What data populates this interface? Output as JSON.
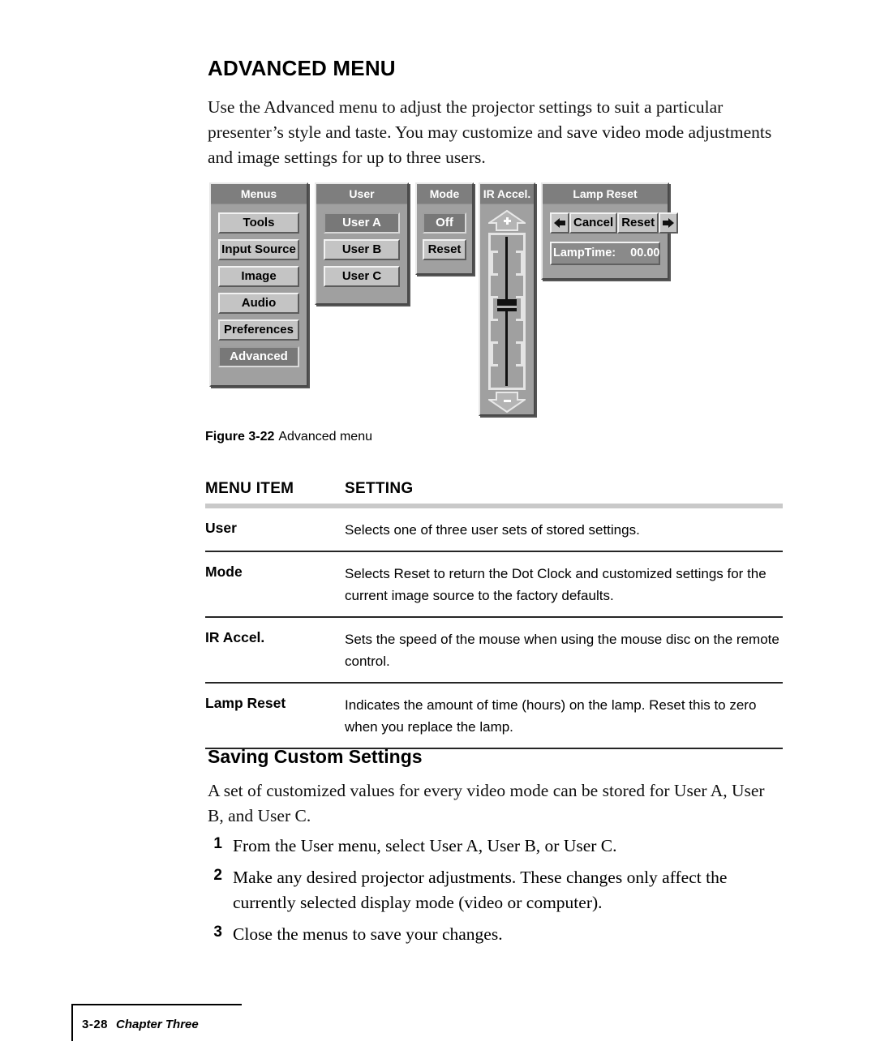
{
  "page": {
    "heading": "ADVANCED MENU",
    "intro_paragraph": "Use the Advanced menu to adjust the projector settings to suit a particular presenter’s style and taste. You may customize and save video mode adjustments and image settings for up to three users."
  },
  "figure": {
    "label": "Figure 3-22",
    "caption": "Advanced menu",
    "panels": {
      "menus": {
        "title": "Menus",
        "items": [
          {
            "label": "Tools",
            "selected": false
          },
          {
            "label": "Input Source",
            "selected": false
          },
          {
            "label": "Image",
            "selected": false
          },
          {
            "label": "Audio",
            "selected": false
          },
          {
            "label": "Preferences",
            "selected": false
          },
          {
            "label": "Advanced",
            "selected": true
          }
        ]
      },
      "user": {
        "title": "User",
        "items": [
          {
            "label": "User A",
            "selected": true
          },
          {
            "label": "User B",
            "selected": false
          },
          {
            "label": "User C",
            "selected": false
          }
        ]
      },
      "mode": {
        "title": "Mode",
        "items": [
          {
            "label": "Off",
            "selected": true
          },
          {
            "label": "Reset",
            "selected": false
          }
        ]
      },
      "ir_accel": {
        "title": "IR Accel.",
        "increase_icon": "up-arrow-plus-icon",
        "decrease_icon": "down-arrow-minus-icon",
        "slider_position_percent": 45
      },
      "lamp_reset": {
        "title": "Lamp Reset",
        "left_arrow_icon": "left-arrow-icon",
        "right_arrow_icon": "right-arrow-icon",
        "cancel_label": "Cancel",
        "reset_label": "Reset",
        "lamp_time_label": "LampTime:",
        "lamp_time_value": "00.00"
      }
    }
  },
  "table": {
    "headers": {
      "item": "MENU ITEM",
      "setting": "SETTING"
    },
    "rows": [
      {
        "item": "User",
        "setting": "Selects one of three user sets of stored settings."
      },
      {
        "item": "Mode",
        "setting": "Selects Reset to return the Dot Clock and customized settings for the current image source to the factory defaults."
      },
      {
        "item": "IR Accel.",
        "setting": "Sets the speed of the mouse when using the mouse disc on the remote control."
      },
      {
        "item": "Lamp Reset",
        "setting": "Indicates the amount of time (hours) on the lamp. Reset this to zero when you replace the lamp."
      }
    ]
  },
  "saving": {
    "heading": "Saving Custom Settings",
    "intro": "A set of customized values for every video mode can be stored for User A, User B, and User C.",
    "steps": [
      {
        "num": "1",
        "text": "From the User menu, select User A, User B, or User C."
      },
      {
        "num": "2",
        "text": "Make any desired projector adjustments. These changes only affect the currently selected display mode (video or computer)."
      },
      {
        "num": "3",
        "text": "Close the menus to save your changes."
      }
    ]
  },
  "footer": {
    "page_number": "3-28",
    "chapter": "Chapter Three"
  }
}
